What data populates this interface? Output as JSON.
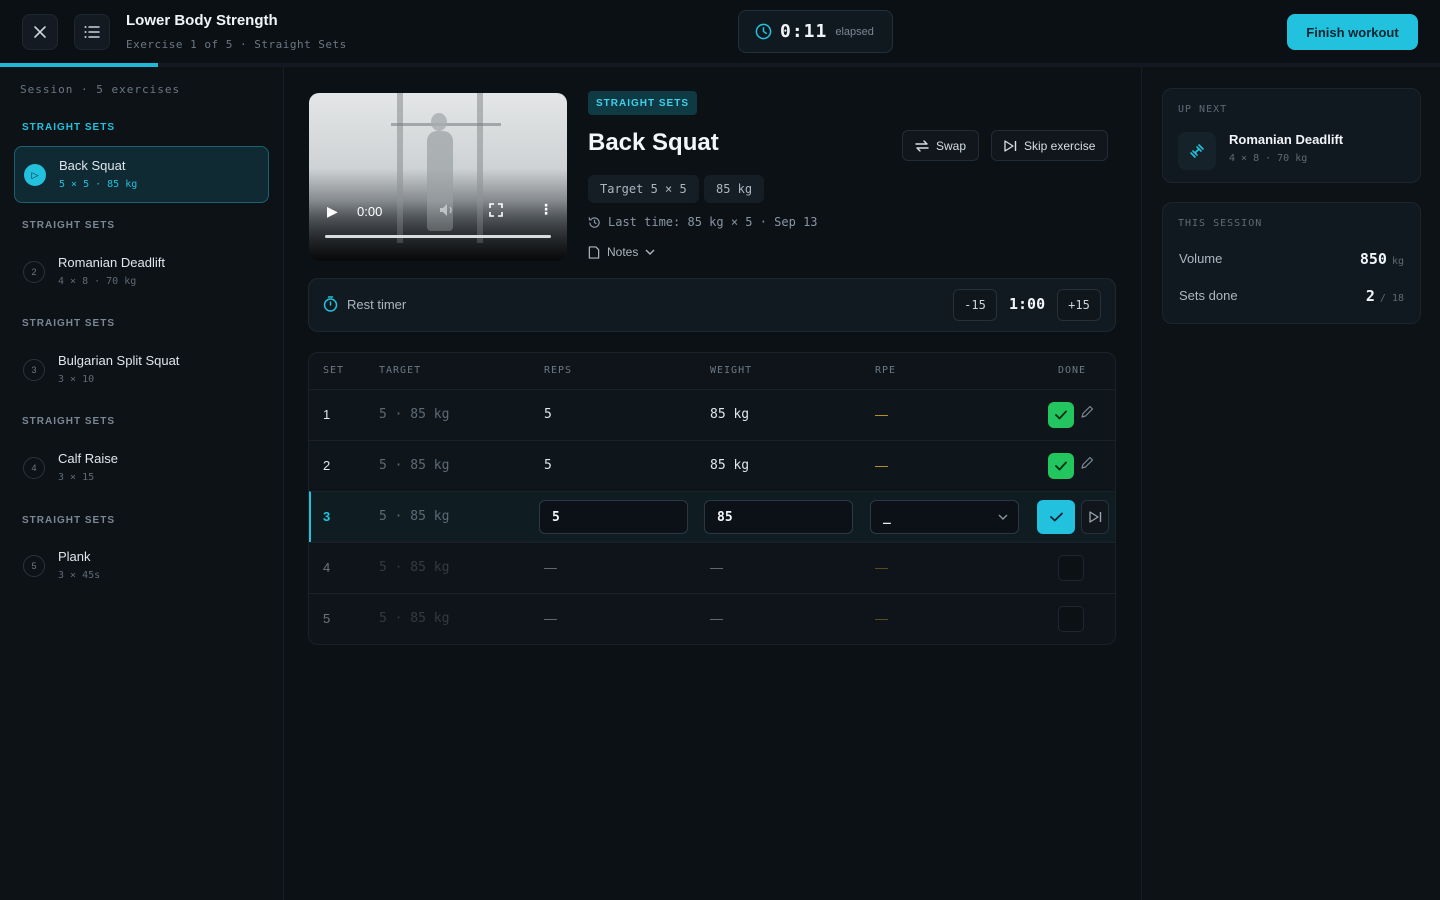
{
  "header": {
    "title": "Lower Body Strength",
    "subtitle": "Exercise 1 of 5 · Straight Sets",
    "elapsed_time": "0:11",
    "elapsed_label": "elapsed",
    "finish_label": "Finish workout",
    "progress_fraction": 0.11
  },
  "sidebar": {
    "session_label": "Session · 5 exercises",
    "items": [
      {
        "group": "STRAIGHT SETS",
        "number": "▷",
        "name": "Back Squat",
        "meta": "5 × 5 · 85 kg",
        "active": true
      },
      {
        "group": "STRAIGHT SETS",
        "number": "2",
        "name": "Romanian Deadlift",
        "meta": "4 × 8 · 70 kg",
        "active": false
      },
      {
        "group": "STRAIGHT SETS",
        "number": "3",
        "name": "Bulgarian Split Squat",
        "meta": "3 × 10",
        "active": false
      },
      {
        "group": "STRAIGHT SETS",
        "number": "4",
        "name": "Calf Raise",
        "meta": "3 × 15",
        "active": false
      },
      {
        "group": "STRAIGHT SETS",
        "number": "5",
        "name": "Plank",
        "meta": "3 × 45s",
        "active": false
      }
    ]
  },
  "video": {
    "time": "0:00"
  },
  "exercise": {
    "tag": "STRAIGHT SETS",
    "title": "Back Squat",
    "swap_label": "Swap",
    "skip_label": "Skip exercise",
    "target_chip": "Target 5 × 5",
    "weight_chip": "85 kg",
    "last_time": "Last time: 85 kg × 5 · Sep 13",
    "notes_label": "Notes"
  },
  "rest_timer": {
    "label": "Rest timer",
    "minus": "-15",
    "value": "1:00",
    "plus": "+15"
  },
  "sets_table": {
    "headers": {
      "set": "SET",
      "target": "TARGET",
      "reps": "REPS",
      "weight": "WEIGHT",
      "rpe": "RPE",
      "done": "DONE"
    },
    "rows": [
      {
        "set": "1",
        "target": "5 · 85 kg",
        "reps": "5",
        "weight": "85 kg",
        "rpe": "—",
        "state": "done"
      },
      {
        "set": "2",
        "target": "5 · 85 kg",
        "reps": "5",
        "weight": "85 kg",
        "rpe": "—",
        "state": "done"
      },
      {
        "set": "3",
        "target": "5 · 85 kg",
        "reps": "5",
        "weight": "85",
        "rpe": "_",
        "state": "active"
      },
      {
        "set": "4",
        "target": "5 · 85 kg",
        "reps": "—",
        "weight": "—",
        "rpe": "—",
        "state": "future"
      },
      {
        "set": "5",
        "target": "5 · 85 kg",
        "reps": "—",
        "weight": "—",
        "rpe": "—",
        "state": "future"
      }
    ]
  },
  "up_next": {
    "label": "UP NEXT",
    "name": "Romanian Deadlift",
    "meta": "4 × 8 · 70 kg"
  },
  "this_session": {
    "label": "THIS SESSION",
    "volume_label": "Volume",
    "volume_value": "850",
    "volume_unit": "kg",
    "sets_label": "Sets done",
    "sets_value": "2",
    "sets_total": "/ 18"
  },
  "colors": {
    "accent": "#22c1de",
    "success": "#22c55e",
    "background": "#0c1116"
  }
}
